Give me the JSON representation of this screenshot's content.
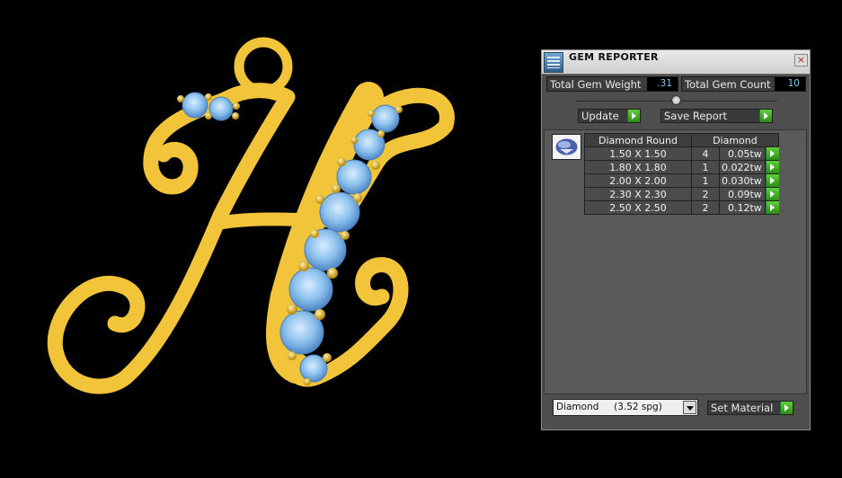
{
  "window": {
    "title": "GEM REPORTER",
    "close_glyph": "×"
  },
  "stats": {
    "weight_label": "Total Gem Weight",
    "weight_value": ".31",
    "count_label": "Total Gem Count",
    "count_value": "10"
  },
  "buttons": {
    "update": "Update",
    "save_report": "Save Report",
    "set_material": "Set Material"
  },
  "table": {
    "headers": [
      "Diamond Round",
      "Diamond"
    ],
    "rows": [
      {
        "size": "1.50 X 1.50",
        "count": "4",
        "weight": "0.05tw"
      },
      {
        "size": "1.80 X 1.80",
        "count": "1",
        "weight": "0.022tw"
      },
      {
        "size": "2.00 X 2.00",
        "count": "1",
        "weight": "0.030tw"
      },
      {
        "size": "2.30 X 2.30",
        "count": "2",
        "weight": "0.09tw"
      },
      {
        "size": "2.50 X 2.50",
        "count": "2",
        "weight": "0.12tw"
      }
    ]
  },
  "material": {
    "selected": "Diamond     (3.52 spg)"
  },
  "colors": {
    "gold": "#f2c43a",
    "gem": "#8ec2ee",
    "panel": "#4e4e4e",
    "accent_green": "#3aa81f"
  },
  "icons": [
    "app-icon",
    "close-icon",
    "gem-thumbnail-icon",
    "go-arrow-icon",
    "dropdown-arrow-icon"
  ]
}
